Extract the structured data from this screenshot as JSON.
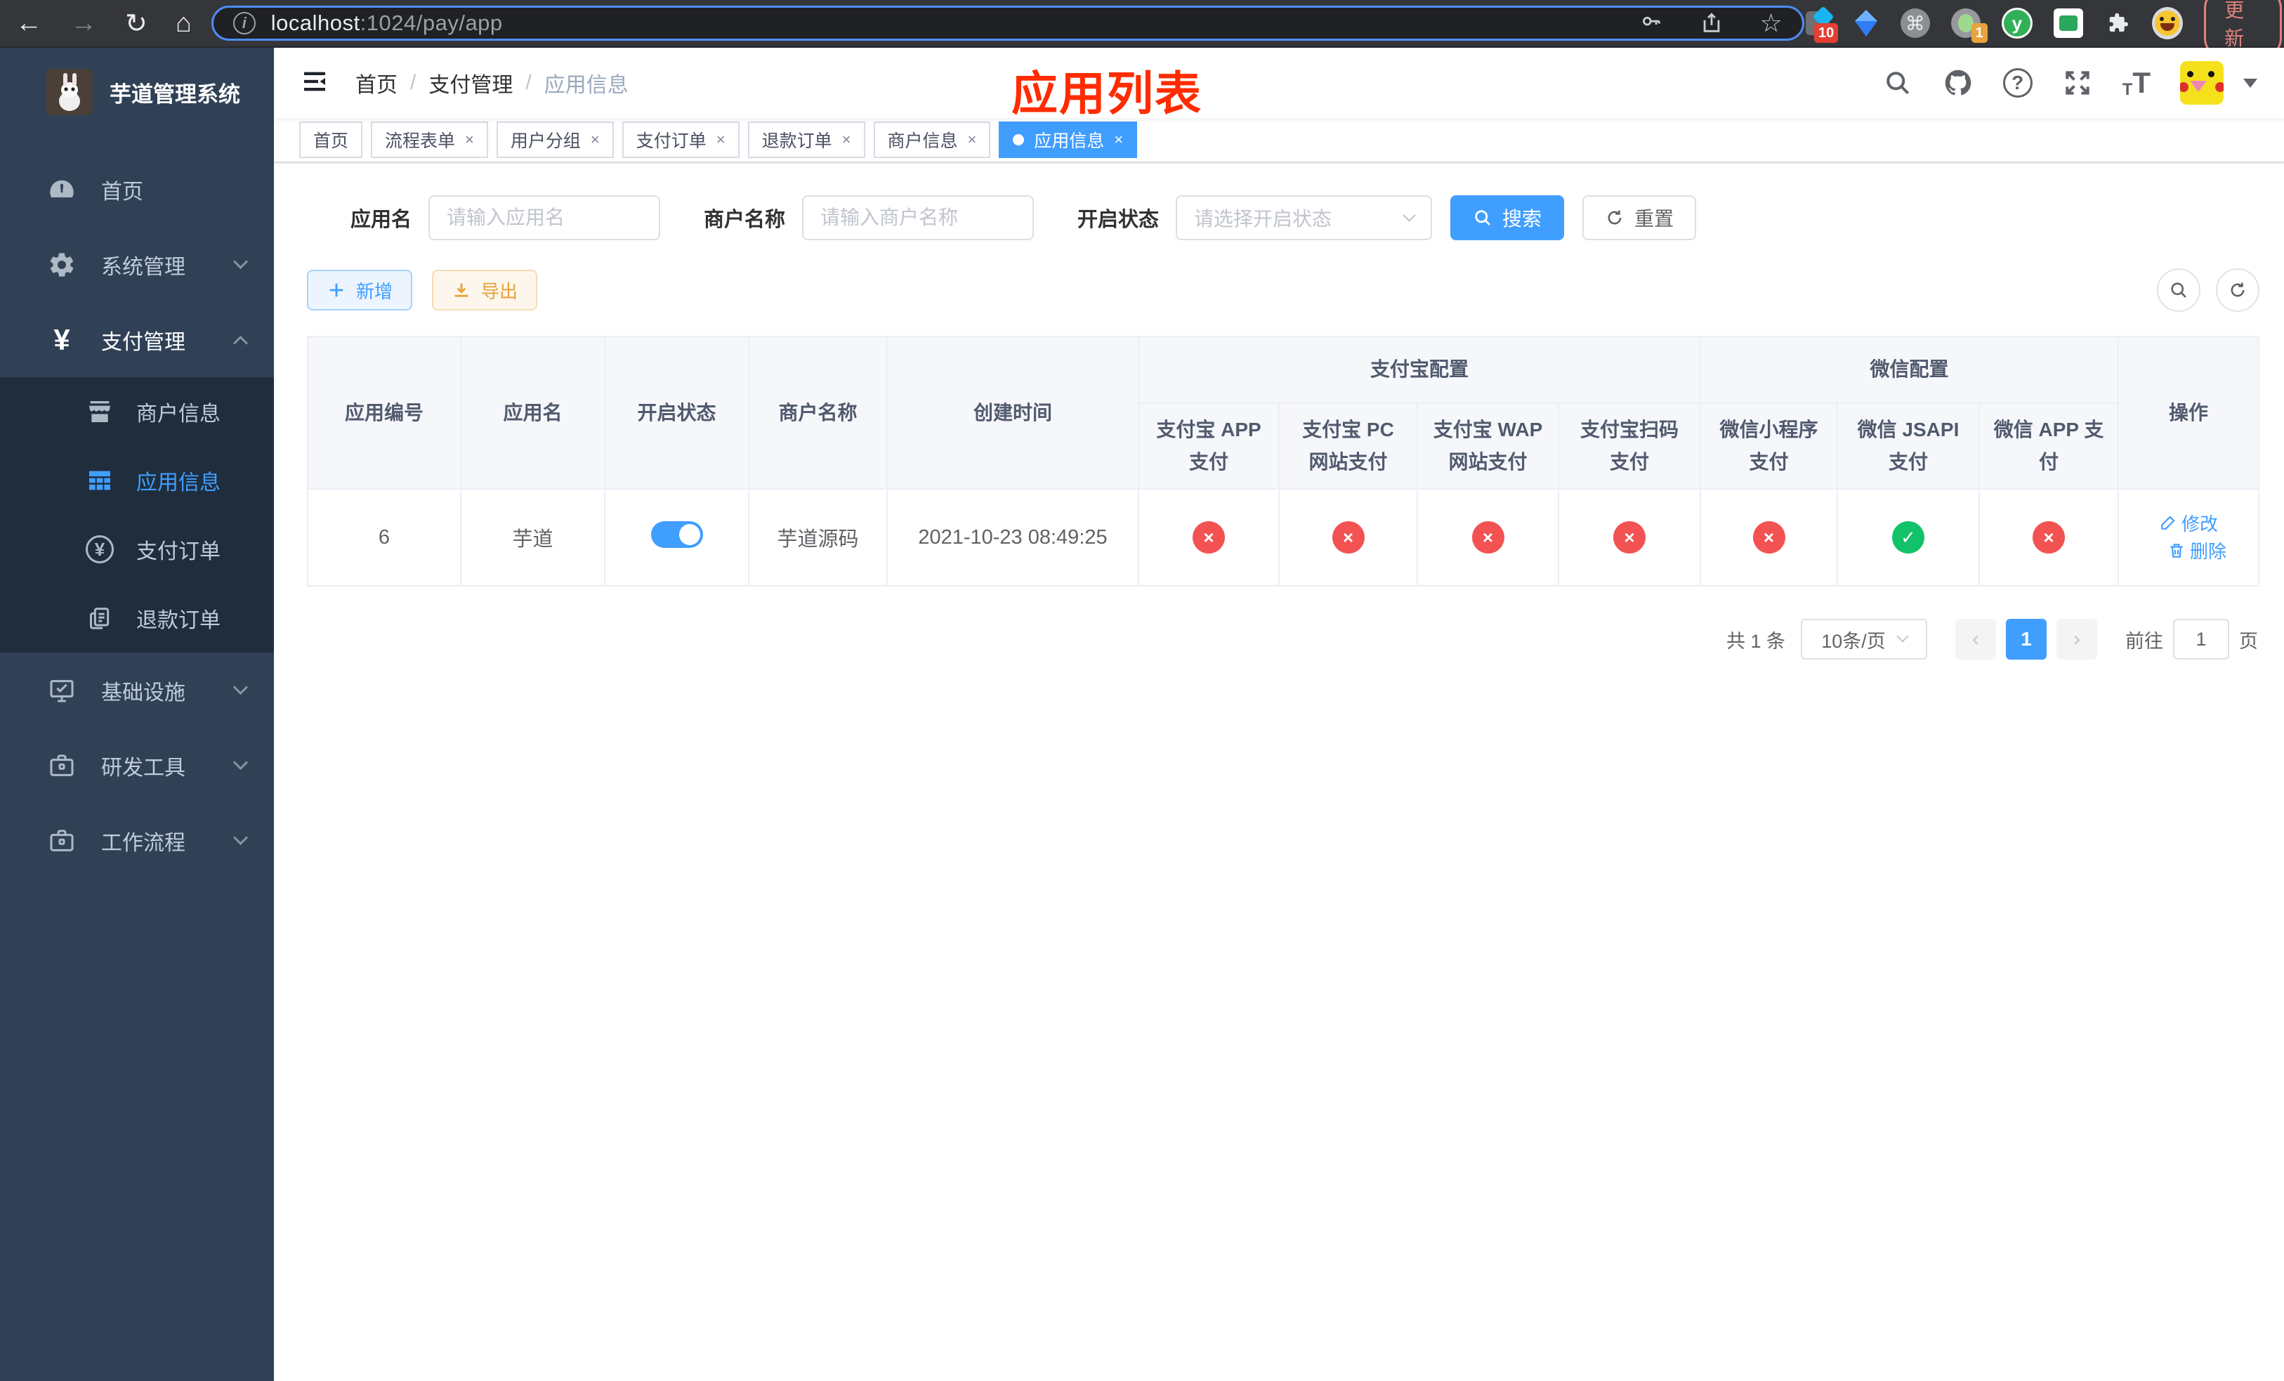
{
  "browser": {
    "url_host": "localhost",
    "url_path": ":1024/pay/app",
    "update_label": "更新",
    "extension_badges": {
      "first": "10",
      "second": "1"
    },
    "yuque_letter": "y"
  },
  "icons": {
    "back": "←",
    "forward": "→",
    "reload": "↻",
    "home": "⌂",
    "info": "i",
    "star": "☆",
    "cmd": "⌘",
    "dots": "⋮",
    "close": "×",
    "cross": "×",
    "check": "✓",
    "yen": "¥",
    "question": "?",
    "prev": "‹",
    "next": "›",
    "font_small": "T",
    "font_large": "T"
  },
  "sidebar": {
    "title": "芋道管理系统",
    "menu": [
      {
        "label": "首页",
        "icon": "dashboard-icon"
      },
      {
        "label": "系统管理",
        "icon": "gear-icon"
      },
      {
        "label": "支付管理",
        "icon": "yen-icon"
      },
      {
        "label": "商户信息",
        "icon": "shop-icon"
      },
      {
        "label": "应用信息",
        "icon": "grid-icon"
      },
      {
        "label": "支付订单",
        "icon": "yen-circle-icon"
      },
      {
        "label": "退款订单",
        "icon": "document-icon"
      },
      {
        "label": "基础设施",
        "icon": "monitor-icon"
      },
      {
        "label": "研发工具",
        "icon": "toolbox-icon"
      },
      {
        "label": "工作流程",
        "icon": "briefcase-icon"
      }
    ]
  },
  "header": {
    "breadcrumb": [
      "首页",
      "支付管理",
      "应用信息"
    ],
    "separator": "/",
    "overlay_title": "应用列表"
  },
  "tabs": [
    {
      "label": "首页"
    },
    {
      "label": "流程表单"
    },
    {
      "label": "用户分组"
    },
    {
      "label": "支付订单"
    },
    {
      "label": "退款订单"
    },
    {
      "label": "商户信息"
    },
    {
      "label": "应用信息"
    }
  ],
  "filters": {
    "app_name_label": "应用名",
    "app_name_placeholder": "请输入应用名",
    "merchant_label": "商户名称",
    "merchant_placeholder": "请输入商户名称",
    "status_label": "开启状态",
    "status_placeholder": "请选择开启状态",
    "search_label": "搜索",
    "reset_label": "重置"
  },
  "toolbar": {
    "add_label": "新增",
    "export_label": "导出"
  },
  "table": {
    "group_headers": {
      "alipay": "支付宝配置",
      "wechat": "微信配置"
    },
    "columns": [
      "应用编号",
      "应用名",
      "开启状态",
      "商户名称",
      "创建时间",
      "支付宝 APP 支付",
      "支付宝 PC 网站支付",
      "支付宝 WAP 网站支付",
      "支付宝扫码支付",
      "微信小程序支付",
      "微信 JSAPI 支付",
      "微信 APP 支付",
      "操作"
    ],
    "rows": [
      {
        "id": "6",
        "name": "芋道",
        "status_on": true,
        "merchant": "芋道源码",
        "created_at": "2021-10-23 08:49:25",
        "channels": {
          "alipay_app": false,
          "alipay_pc": false,
          "alipay_wap": false,
          "alipay_qr": false,
          "wx_mini": false,
          "wx_jsapi": true,
          "wx_app": false
        },
        "edit_label": "修改",
        "delete_label": "删除"
      }
    ]
  },
  "pagination": {
    "total_text": "共 1 条",
    "page_size": "10条/页",
    "current_page": "1",
    "goto_prefix": "前往",
    "goto_value": "1",
    "goto_suffix": "页"
  }
}
